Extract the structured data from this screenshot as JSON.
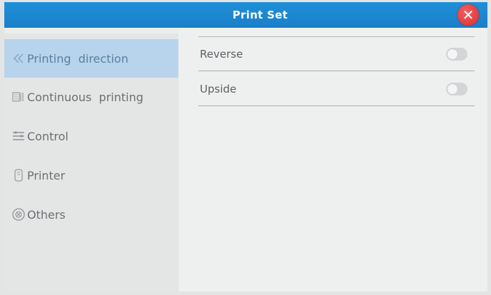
{
  "window": {
    "title": "Print Set",
    "close_icon": "close-icon"
  },
  "sidebar": {
    "items": [
      {
        "label": "Printing  direction",
        "icon": "double-chevron-left-icon",
        "active": true
      },
      {
        "label": "Continuous  printing",
        "icon": "continuous-print-icon",
        "active": false
      },
      {
        "label": "Control",
        "icon": "control-lines-icon",
        "active": false
      },
      {
        "label": "Printer",
        "icon": "printer-icon",
        "active": false
      },
      {
        "label": "Others",
        "icon": "others-circle-icon",
        "active": false
      }
    ]
  },
  "settings": {
    "rows": [
      {
        "label": "Reverse",
        "enabled": false
      },
      {
        "label": "Upside",
        "enabled": false
      }
    ]
  },
  "colors": {
    "titlebar": "#1a86d0",
    "close_button": "#e03a3a",
    "active_item_bg": "#b8d4ec",
    "active_item_text": "#5b7f9d"
  }
}
